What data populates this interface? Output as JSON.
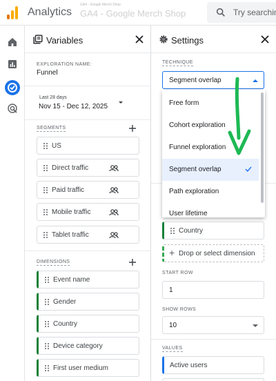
{
  "topbar": {
    "app_title": "Analytics",
    "account_line": "GA4 - Google Merch Shop",
    "property_name": "GA4 - Google Merch Shop",
    "search_placeholder": "Try searching"
  },
  "rail": {
    "items": [
      {
        "icon": "home-icon"
      },
      {
        "icon": "reports-icon"
      },
      {
        "icon": "explore-icon",
        "active": true
      },
      {
        "icon": "advertising-icon"
      }
    ]
  },
  "variables": {
    "title": "Variables",
    "exploration_name_label": "EXPLORATION NAME:",
    "exploration_name": "Funnel",
    "date_preset": "Last 28 days",
    "date_range": "Nov 15 - Dec 12, 2025",
    "segments_label": "SEGMENTS",
    "segments": [
      "US",
      "Direct traffic",
      "Paid traffic",
      "Mobile traffic",
      "Tablet traffic"
    ],
    "dimensions_label": "DIMENSIONS",
    "dimensions": [
      "Event name",
      "Gender",
      "Country",
      "Device category",
      "First user medium"
    ]
  },
  "settings": {
    "title": "Settings",
    "technique_label": "TECHNIQUE",
    "technique_value": "Segment overlap",
    "technique_options": [
      "Free form",
      "Cohort exploration",
      "Funnel exploration",
      "Segment overlap",
      "Path exploration",
      "User lifetime"
    ],
    "selected_option": "Segment overlap",
    "dimension_chip": "Country",
    "drop_dimension": "Drop or select dimension",
    "start_row_label": "START ROW",
    "start_row": "1",
    "show_rows_label": "SHOW ROWS",
    "show_rows": "10",
    "values_label": "VALUES",
    "value_chip": "Active users"
  },
  "colors": {
    "accent": "#1a73e8",
    "dimension_green": "#188038",
    "arrow_green": "#1db954",
    "logo_orange": "#f9ab00",
    "logo_dark": "#e37400"
  }
}
